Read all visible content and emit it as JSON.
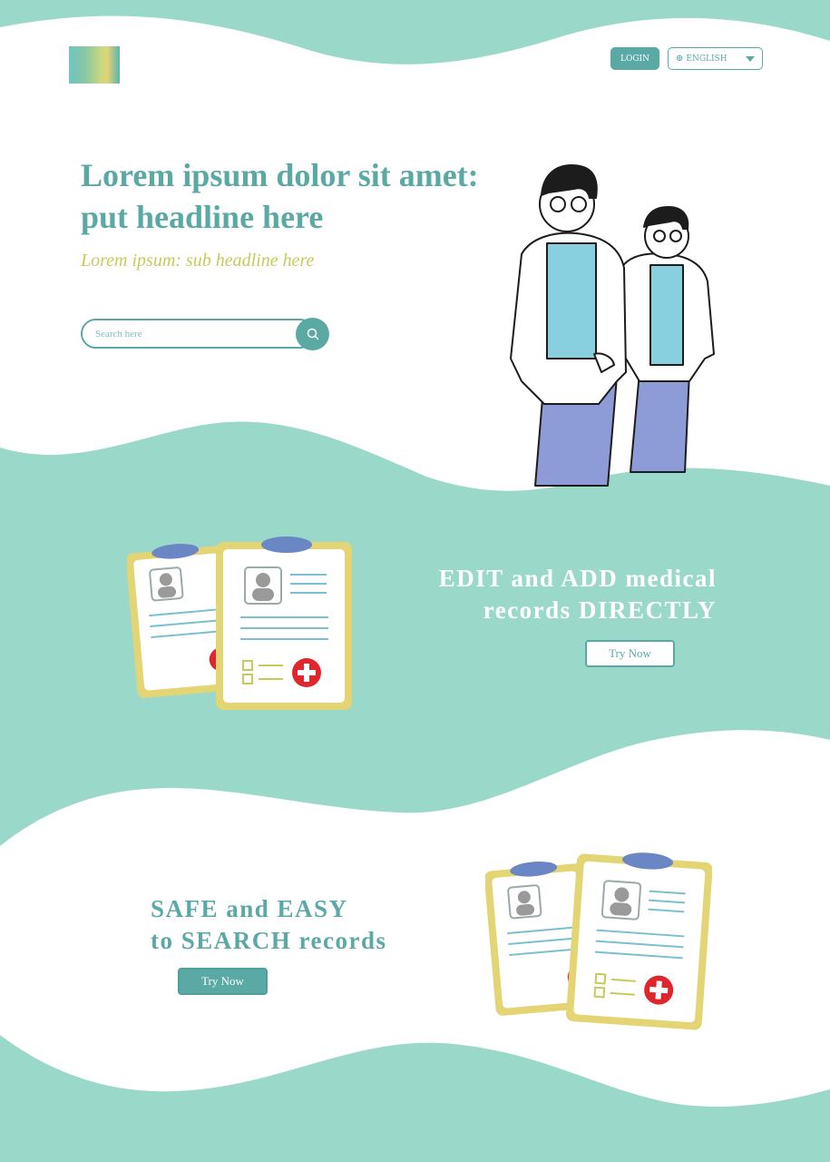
{
  "header": {
    "login_label": "LOGIN",
    "language": {
      "selected": "ENGLISH",
      "icon": "globe-icon"
    }
  },
  "hero": {
    "headline": "Lorem ipsum dolor sit amet: put headline here",
    "subheadline": "Lorem ipsum: sub headline here",
    "search": {
      "placeholder": "Search here",
      "icon": "search-icon"
    }
  },
  "promo1": {
    "title_line1": "EDIT and ADD medical",
    "title_line2": "records DIRECTLY",
    "button_label": "Try Now"
  },
  "promo2": {
    "title_line1": "SAFE and EASY",
    "title_line2": "to SEARCH records",
    "button_label": "Try Now"
  },
  "colors": {
    "teal": "#5aa9a5",
    "mint": "#9ad9c9",
    "olive": "#c8c95a",
    "white": "#ffffff"
  }
}
